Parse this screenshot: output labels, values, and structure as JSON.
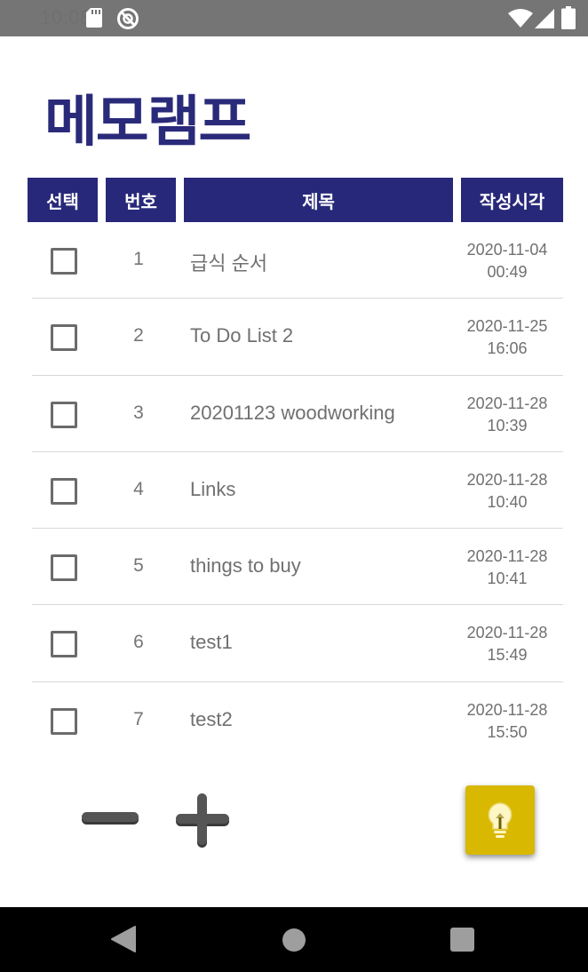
{
  "status_bar": {
    "time": "10:08",
    "icons": [
      "sd-card-icon",
      "do-not-disturb-icon",
      "wifi-icon",
      "signal-icon",
      "battery-icon"
    ]
  },
  "app": {
    "title": "메모램프"
  },
  "table": {
    "headers": {
      "select": "선택",
      "number": "번호",
      "title": "제목",
      "time": "작성시각"
    },
    "rows": [
      {
        "number": "1",
        "title": "급식 순서",
        "date": "2020-11-04",
        "clock": "00:49",
        "checked": false
      },
      {
        "number": "2",
        "title": "To Do List 2",
        "date": "2020-11-25",
        "clock": "16:06",
        "checked": false
      },
      {
        "number": "3",
        "title": "20201123 woodworking",
        "date": "2020-11-28",
        "clock": "10:39",
        "checked": false
      },
      {
        "number": "4",
        "title": "Links",
        "date": "2020-11-28",
        "clock": "10:40",
        "checked": false
      },
      {
        "number": "5",
        "title": "things to buy",
        "date": "2020-11-28",
        "clock": "10:41",
        "checked": false
      },
      {
        "number": "6",
        "title": "test1",
        "date": "2020-11-28",
        "clock": "15:49",
        "checked": false
      },
      {
        "number": "7",
        "title": "test2",
        "date": "2020-11-28",
        "clock": "15:50",
        "checked": false
      }
    ]
  },
  "controls": {
    "delete_icon": "minus-icon",
    "add_icon": "plus-icon",
    "lamp_icon": "lightbulb-icon"
  },
  "colors": {
    "header_bg": "#28287a",
    "title_color": "#2a2a7a",
    "lamp_button": "#d8b800",
    "status_bar": "#757575"
  }
}
